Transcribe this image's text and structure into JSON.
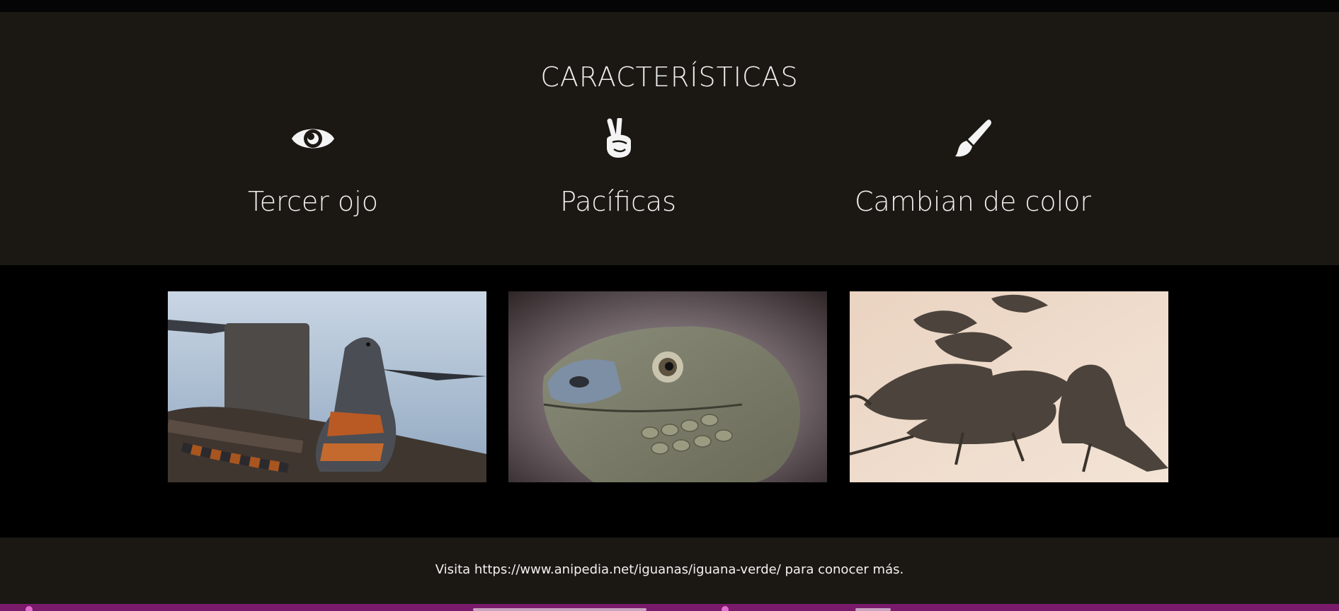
{
  "features": {
    "title": "CARACTERÍSTICAS",
    "items": [
      {
        "icon": "eye-icon",
        "label": "Tercer ojo"
      },
      {
        "icon": "peace-hand-icon",
        "label": "Pacíficas"
      },
      {
        "icon": "paint-brush-icon",
        "label": "Cambian de color"
      }
    ]
  },
  "gallery": {
    "photos": [
      {
        "subject": "iguana-on-rocks-by-water"
      },
      {
        "subject": "iguana-head-closeup"
      },
      {
        "subject": "iguanas-on-sand"
      }
    ]
  },
  "footer": {
    "text": "Visita https://www.anipedia.net/iguanas/iguana-verde/ para conocer más."
  },
  "colors": {
    "section_bg": "#1b1814",
    "page_bg": "#000000",
    "text": "#f2f2f2",
    "taskbar": "#7a1a6a"
  }
}
